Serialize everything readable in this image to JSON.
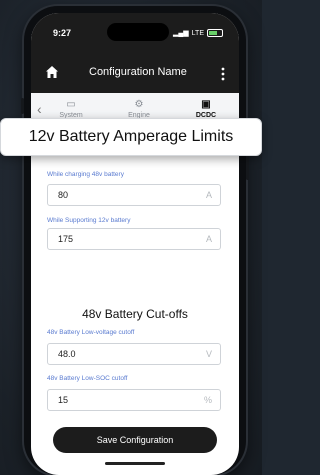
{
  "status": {
    "time": "9:27",
    "network": "LTE"
  },
  "header": {
    "title": "Configuration Name"
  },
  "tabs": [
    {
      "label": "System",
      "icon": "monitor-icon"
    },
    {
      "label": "Engine",
      "icon": "engine-icon"
    },
    {
      "label": "DCDC",
      "icon": "battery-icon"
    }
  ],
  "tooltip": {
    "text": "12v Battery Amperage Limits"
  },
  "amperage": {
    "fields": [
      {
        "label": "While charging 48v battery",
        "value": "80",
        "unit": "A"
      },
      {
        "label": "While Supporting 12v battery",
        "value": "175",
        "unit": "A"
      }
    ]
  },
  "cutoffs": {
    "title": "48v Battery Cut-offs",
    "fields": [
      {
        "label": "48v Battery Low-voltage cutoff",
        "value": "48.0",
        "unit": "V"
      },
      {
        "label": "48v Battery Low-SOC cutoff",
        "value": "15",
        "unit": "%"
      }
    ]
  },
  "footer": {
    "save_label": "Save Configuration"
  }
}
